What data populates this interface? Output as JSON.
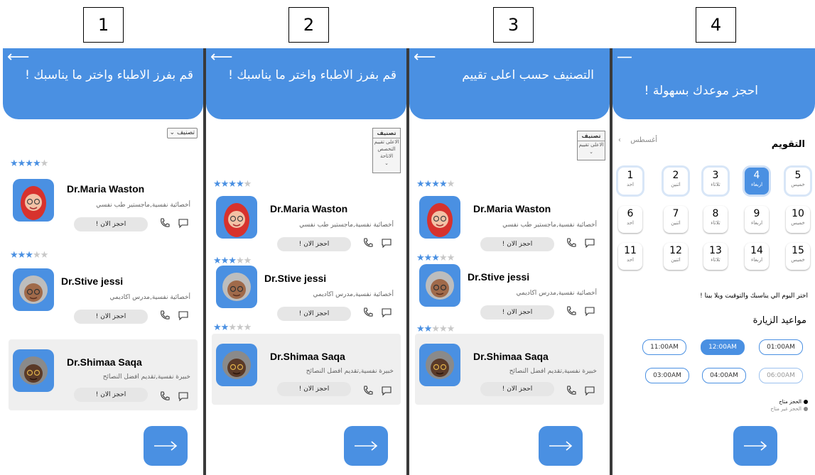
{
  "panels": [
    "1",
    "2",
    "3",
    "4"
  ],
  "colors": {
    "primary": "#4a90e2",
    "card_highlight": "#efefef",
    "button_grey": "#e6e6e6"
  },
  "screen1": {
    "title": "قم بفرز الاطباء واختر ما يناسبك !",
    "sort_label": "تصنيف"
  },
  "screen2": {
    "title": "قم بفرز الاطباء واختر ما يناسبك !",
    "sort_label": "تصنيف",
    "sort_options": [
      "الاعلى تقييم",
      "التخصص",
      "الاتاحة"
    ]
  },
  "screen3": {
    "title": "التصنيف حسب اعلى تقييم",
    "sort_label": "تصنيف",
    "sort_options": [
      "الاعلى تقييم"
    ]
  },
  "doctors": [
    {
      "name": "Dr.Maria Waston",
      "desc": "أخصائية نفسية,ماجستير طب نفسي",
      "rating": 4,
      "book": "احجز الان !"
    },
    {
      "name": "Dr.Stive jessi",
      "desc": "أخصائية نفسية,مدرس اكاديمي",
      "rating": 3,
      "book": "احجز الان !"
    },
    {
      "name": "Dr.Shimaa Saqa",
      "desc": "خبيرة نفسية,تقديم افضل النصائح",
      "rating": 2,
      "book": "احجز الان !"
    }
  ],
  "screen4": {
    "title": "احجز موعدك بسهولة !",
    "calendar_title": "التقويم",
    "month": "أغسطس",
    "days": [
      {
        "num": "1",
        "label": "احد"
      },
      {
        "num": "2",
        "label": "اثنين"
      },
      {
        "num": "3",
        "label": "ثلاثاء"
      },
      {
        "num": "4",
        "label": "اربعاء"
      },
      {
        "num": "5",
        "label": "خميس"
      },
      {
        "num": "6",
        "label": "احد"
      },
      {
        "num": "7",
        "label": "اثنين"
      },
      {
        "num": "8",
        "label": "ثلاثاء"
      },
      {
        "num": "9",
        "label": "اربعاء"
      },
      {
        "num": "10",
        "label": "خميس"
      },
      {
        "num": "11",
        "label": "احد"
      },
      {
        "num": "12",
        "label": "اثنين"
      },
      {
        "num": "13",
        "label": "ثلاثاء"
      },
      {
        "num": "14",
        "label": "اربعاء"
      },
      {
        "num": "15",
        "label": "خميس"
      }
    ],
    "selected_day": "4",
    "choose_text": "اختر اليوم الي يناسبك والتوقيت ويلا بينا !",
    "visits_title": "مواعيد الزيارة",
    "slots": [
      {
        "time": "11:00AM",
        "state": "available"
      },
      {
        "time": "12:00AM",
        "state": "selected"
      },
      {
        "time": "01:00AM",
        "state": "available"
      },
      {
        "time": "03:00AM",
        "state": "available"
      },
      {
        "time": "04:00AM",
        "state": "available"
      },
      {
        "time": "06:00AM",
        "state": "unavailable"
      }
    ],
    "legend_available": "الحجز متاح",
    "legend_unavailable": "الحجز غير متاح"
  }
}
